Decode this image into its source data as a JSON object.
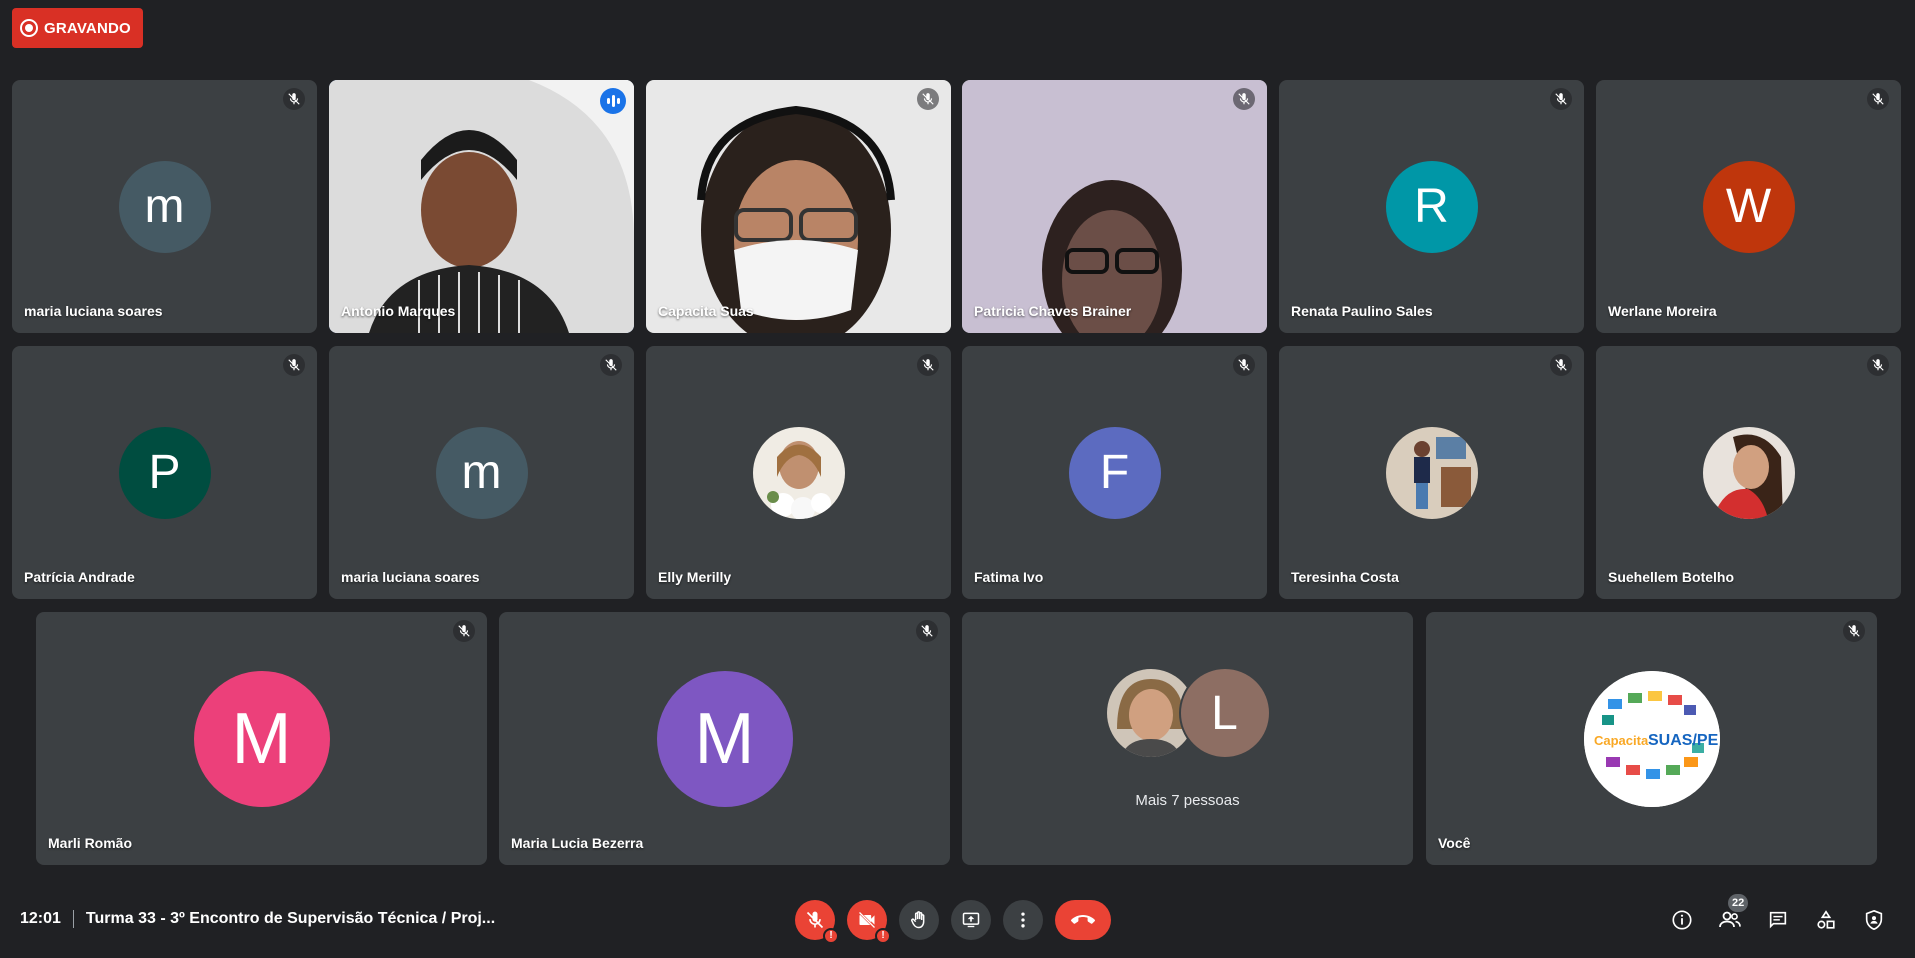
{
  "recording": {
    "label": "GRAVANDO"
  },
  "tiles": [
    {
      "name": "maria luciana soares",
      "initial": "m",
      "color": "#455a64"
    },
    {
      "name": "Antonio Marques"
    },
    {
      "name": "Capacita Suas"
    },
    {
      "name": "Patricia Chaves Brainer"
    },
    {
      "name": "Renata Paulino Sales",
      "initial": "R",
      "color": "#0097a7"
    },
    {
      "name": "Werlane Moreira",
      "initial": "W",
      "color": "#bf360c"
    },
    {
      "name": "Patrícia Andrade",
      "initial": "P",
      "color": "#004d40"
    },
    {
      "name": "maria luciana soares",
      "initial": "m",
      "color": "#455a64"
    },
    {
      "name": "Elly Merilly"
    },
    {
      "name": "Fatima Ivo",
      "initial": "F",
      "color": "#5c6bc0"
    },
    {
      "name": "Teresinha Costa"
    },
    {
      "name": "Suehellem Botelho"
    },
    {
      "name": "Marli Romão",
      "initial": "M",
      "color": "#ec407a"
    },
    {
      "name": "Maria Lucia Bezerra",
      "initial": "M",
      "color": "#7e57c2"
    },
    {
      "name": "",
      "more_label": "Mais 7 pessoas",
      "initial": "L",
      "color": "#8d6e63"
    },
    {
      "name": "Você",
      "logo_text_a": "Capacita",
      "logo_text_b": "SUAS/PE"
    }
  ],
  "bottombar": {
    "time": "12:01",
    "meeting_title": "Turma 33 - 3º Encontro de Supervisão Técnica / Proj...",
    "warn_mark": "!",
    "participants_count": "22"
  },
  "colors": {
    "accent": "#8ab4f8",
    "danger": "#ea4335",
    "tile": "#3c4043",
    "bg": "#202124"
  }
}
